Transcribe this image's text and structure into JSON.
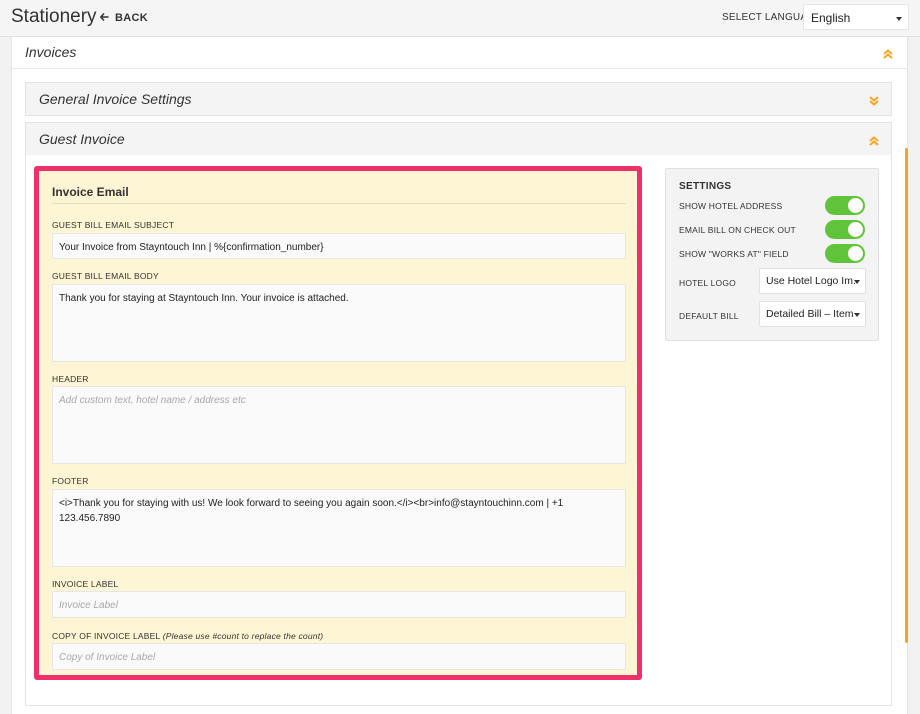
{
  "header": {
    "title": "Stationery",
    "back_label": "BACK",
    "language_label": "SELECT LANGUAGE",
    "language_value": "English"
  },
  "invoices": {
    "title": "Invoices"
  },
  "sections": {
    "general": {
      "title": "General Invoice Settings"
    },
    "guest": {
      "title": "Guest Invoice"
    }
  },
  "invoice_email": {
    "title": "Invoice Email",
    "subject": {
      "label": "GUEST BILL EMAIL SUBJECT",
      "value": "Your Invoice from Stayntouch Inn | %{confirmation_number}"
    },
    "body": {
      "label": "GUEST BILL EMAIL BODY",
      "value": "Thank you for staying at Stayntouch Inn. Your invoice is attached."
    },
    "header_field": {
      "label": "HEADER",
      "placeholder": "Add custom text, hotel name / address etc"
    },
    "footer_field": {
      "label": "FOOTER",
      "value": "<i>Thank you for staying with us! We look forward to seeing you again soon.</i><br>info@stayntouchinn.com  |  +1 123.456.7890"
    },
    "invoice_label": {
      "label": "INVOICE LABEL",
      "placeholder": "Invoice Label"
    },
    "copy_label": {
      "label": "COPY OF INVOICE LABEL",
      "hint": "(Please use #count to replace the count)",
      "placeholder": "Copy of Invoice Label"
    }
  },
  "settings": {
    "title": "SETTINGS",
    "show_hotel_address": {
      "label": "SHOW HOTEL ADDRESS",
      "on": true
    },
    "email_bill_checkout": {
      "label": "EMAIL BILL ON CHECK OUT",
      "on": true
    },
    "show_works_at": {
      "label": "SHOW \"WORKS AT\" FIELD",
      "on": true
    },
    "hotel_logo": {
      "label": "HOTEL LOGO",
      "value": "Use Hotel Logo Im."
    },
    "default_bill": {
      "label": "DEFAULT BILL",
      "value": "Detailed Bill – Item"
    }
  },
  "colors": {
    "accent": "#f5a623",
    "highlight_border": "#f0306a",
    "toggle_on": "#5fc43a",
    "form_bg": "#fdf5d3"
  }
}
